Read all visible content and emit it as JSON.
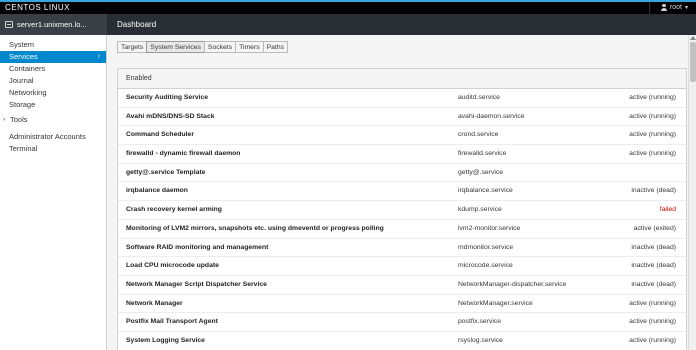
{
  "topbar": {
    "brand": "CENTOS LINUX",
    "user": "root"
  },
  "host": {
    "name": "server1.unixmen.lo..."
  },
  "header": {
    "title": "Dashboard"
  },
  "sidebar": {
    "items": [
      {
        "label": "System"
      },
      {
        "label": "Services"
      },
      {
        "label": "Containers"
      },
      {
        "label": "Journal"
      },
      {
        "label": "Networking"
      },
      {
        "label": "Storage"
      }
    ],
    "tools": "Tools",
    "tools_items": [
      {
        "label": "Administrator Accounts"
      },
      {
        "label": "Terminal"
      }
    ]
  },
  "tabs": [
    {
      "label": "Targets"
    },
    {
      "label": "System Services"
    },
    {
      "label": "Sockets"
    },
    {
      "label": "Timers"
    },
    {
      "label": "Paths"
    }
  ],
  "panel": {
    "heading": "Enabled",
    "rows": [
      {
        "desc": "Security Auditing Service",
        "unit": "auditd.service",
        "state": "active (running)"
      },
      {
        "desc": "Avahi mDNS/DNS-SD Stack",
        "unit": "avahi-daemon.service",
        "state": "active (running)"
      },
      {
        "desc": "Command Scheduler",
        "unit": "crond.service",
        "state": "active (running)"
      },
      {
        "desc": "firewalld - dynamic firewall daemon",
        "unit": "firewalld.service",
        "state": "active (running)"
      },
      {
        "desc": "getty@.service Template",
        "unit": "getty@.service",
        "state": ""
      },
      {
        "desc": "irqbalance daemon",
        "unit": "irqbalance.service",
        "state": "inactive (dead)"
      },
      {
        "desc": "Crash recovery kernel arming",
        "unit": "kdump.service",
        "state": "failed"
      },
      {
        "desc": "Monitoring of LVM2 mirrors, snapshots etc. using dmeventd or progress polling",
        "unit": "lvm2-monitor.service",
        "state": "active (exited)"
      },
      {
        "desc": "Software RAID monitoring and management",
        "unit": "mdmonitor.service",
        "state": "inactive (dead)"
      },
      {
        "desc": "Load CPU microcode update",
        "unit": "microcode.service",
        "state": "inactive (dead)"
      },
      {
        "desc": "Network Manager Script Dispatcher Service",
        "unit": "NetworkManager-dispatcher.service",
        "state": "inactive (dead)"
      },
      {
        "desc": "Network Manager",
        "unit": "NetworkManager.service",
        "state": "active (running)"
      },
      {
        "desc": "Postfix Mail Transport Agent",
        "unit": "postfix.service",
        "state": "active (running)"
      },
      {
        "desc": "System Logging Service",
        "unit": "rsyslog.service",
        "state": "active (running)"
      }
    ]
  },
  "colors": {
    "accent": "#0088ce",
    "failed": "#cc0000",
    "topbar": "#030303"
  }
}
